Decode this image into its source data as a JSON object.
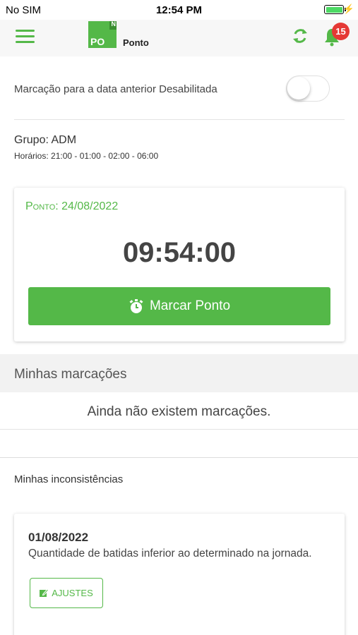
{
  "status_bar": {
    "carrier": "No SIM",
    "time": "12:54 PM",
    "battery": 1.0
  },
  "app_bar": {
    "logo_text": "PO",
    "logo_corner": "N",
    "title": "Ponto",
    "notification_count": "15",
    "icons": [
      "menu-icon",
      "sync-icon",
      "bell-icon"
    ],
    "accent_color": "#54b848",
    "badge_color": "#e53935"
  },
  "settings": {
    "previous_date_label": "Marcação para a data anterior Desabilitada",
    "previous_date_enabled": false
  },
  "group": {
    "name": "Grupo: ADM",
    "hours": "Horários: 21:00 - 01:00 - 02:00 - 06:00"
  },
  "punch": {
    "date_label": "Ponto",
    "date_value": ": 24/08/2022",
    "time": "09:54:00",
    "button_label": "Marcar Ponto",
    "button_icon": "stopwatch-icon"
  },
  "my_punches": {
    "title": "Minhas marcações",
    "empty_message": "Ainda não existem marcações."
  },
  "inconsistencies": {
    "title": "Minhas inconsistências",
    "items": [
      {
        "date": "01/08/2022",
        "description": "Quantidade de batidas inferior ao determinado na jornada.",
        "action_label": "AJUSTES",
        "action_icon": "edit-icon"
      }
    ]
  }
}
